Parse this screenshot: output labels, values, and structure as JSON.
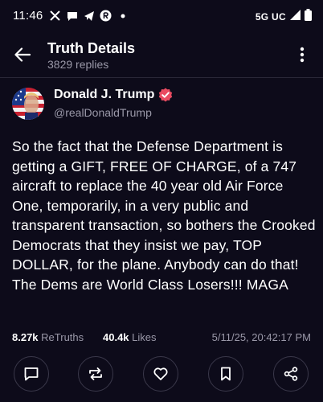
{
  "status_bar": {
    "time": "11:46",
    "network": "5G UC",
    "icons": [
      "x-icon",
      "chat-bubble-icon",
      "telegram-icon",
      "r-app-icon",
      "dot-icon",
      "signal-icon",
      "battery-icon"
    ]
  },
  "header": {
    "title": "Truth Details",
    "subtitle": "3829 replies"
  },
  "post": {
    "author_name": "Donald J. Trump",
    "author_handle": "@realDonaldTrump",
    "body": "So the fact that the Defense Department is getting a GIFT, FREE OF CHARGE, of a 747 aircraft to replace the 40 year old Air Force One, temporarily, in a very public and transparent transaction, so bothers the Crooked Democrats that they insist we pay, TOP DOLLAR, for the plane. Anybody can do that! The Dems are World Class Losers!!! MAGA",
    "retruths_count": "8.27k",
    "retruths_label": "ReTruths",
    "likes_count": "40.4k",
    "likes_label": "Likes",
    "timestamp": "5/11/25, 20:42:17 PM"
  },
  "actions": [
    "reply-icon",
    "retruth-icon",
    "like-icon",
    "bookmark-icon",
    "share-icon"
  ],
  "colors": {
    "background": "#0d0b1a",
    "accent": "#e94b61",
    "muted_text": "#9a98a8",
    "divider": "#2a2838"
  }
}
